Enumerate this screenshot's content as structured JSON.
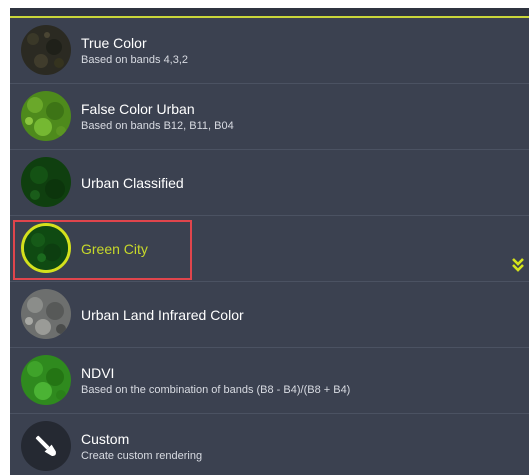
{
  "panel": {
    "accent_color": "#c9d63a",
    "highlight_color": "#e0454c",
    "items": [
      {
        "title": "True Color",
        "subtitle": "Based on bands 4,3,2",
        "icon": "true-color-thumbnail"
      },
      {
        "title": "False Color Urban",
        "subtitle": "Based on bands B12, B11, B04",
        "icon": "false-color-urban-thumbnail"
      },
      {
        "title": "Urban Classified",
        "subtitle": "",
        "icon": "urban-classified-thumbnail"
      },
      {
        "title": "Green City",
        "subtitle": "",
        "icon": "green-city-thumbnail",
        "selected": true
      },
      {
        "title": "Urban Land Infrared Color",
        "subtitle": "",
        "icon": "urban-land-infrared-thumbnail"
      },
      {
        "title": "NDVI",
        "subtitle": "Based on the combination of bands (B8 - B4)/(B8 + B4)",
        "icon": "ndvi-thumbnail"
      },
      {
        "title": "Custom",
        "subtitle": "Create custom rendering",
        "icon": "brush-icon"
      }
    ],
    "expand_icon": "double-chevron-down-icon"
  }
}
